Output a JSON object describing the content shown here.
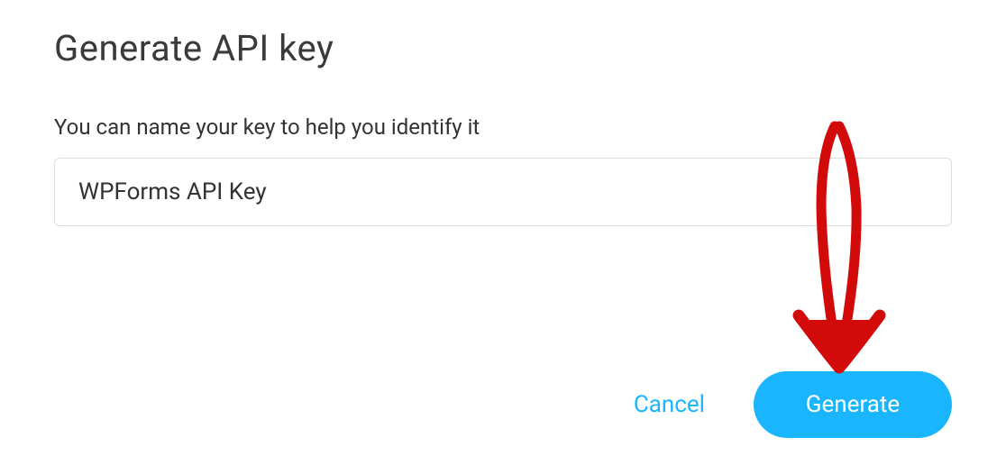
{
  "dialog": {
    "title": "Generate API key",
    "field_label": "You can name your key to help you identify it",
    "input_value": "WPForms API Key"
  },
  "actions": {
    "cancel_label": "Cancel",
    "generate_label": "Generate"
  },
  "annotation": {
    "stroke_color": "#d20a0a"
  }
}
